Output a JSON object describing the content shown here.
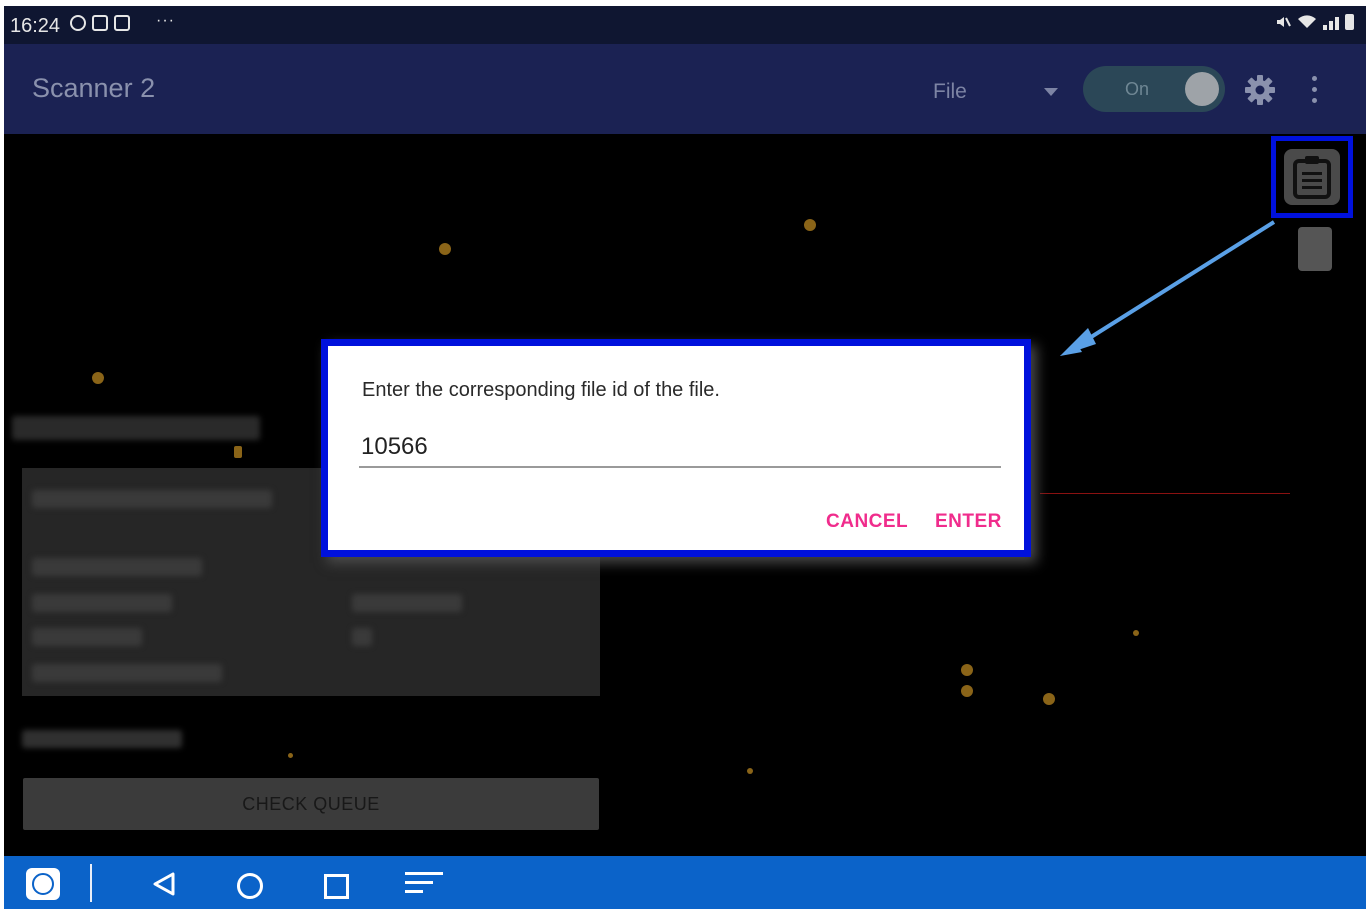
{
  "status_bar": {
    "time": "16:24",
    "more": "···",
    "icons": [
      "eye-icon",
      "screen-share-icon",
      "mail-icon",
      "mute-icon",
      "wifi-icon",
      "signal-icon",
      "battery-icon"
    ]
  },
  "app_bar": {
    "title": "Scanner 2",
    "mode_select": "File",
    "toggle_label": "On"
  },
  "main": {
    "check_queue_label": "CHECK QUEUE"
  },
  "dialog": {
    "prompt": "Enter the corresponding file id of the file.",
    "input_value": "10566",
    "cancel_label": "CANCEL",
    "enter_label": "ENTER"
  },
  "colors": {
    "app_bar": "#1b2253",
    "status_bar": "#0f1631",
    "nav_bar": "#0b63c9",
    "highlight": "#0011dd",
    "dialog_button": "#f02c8c",
    "annotation_arrow": "#5aa0e6"
  }
}
